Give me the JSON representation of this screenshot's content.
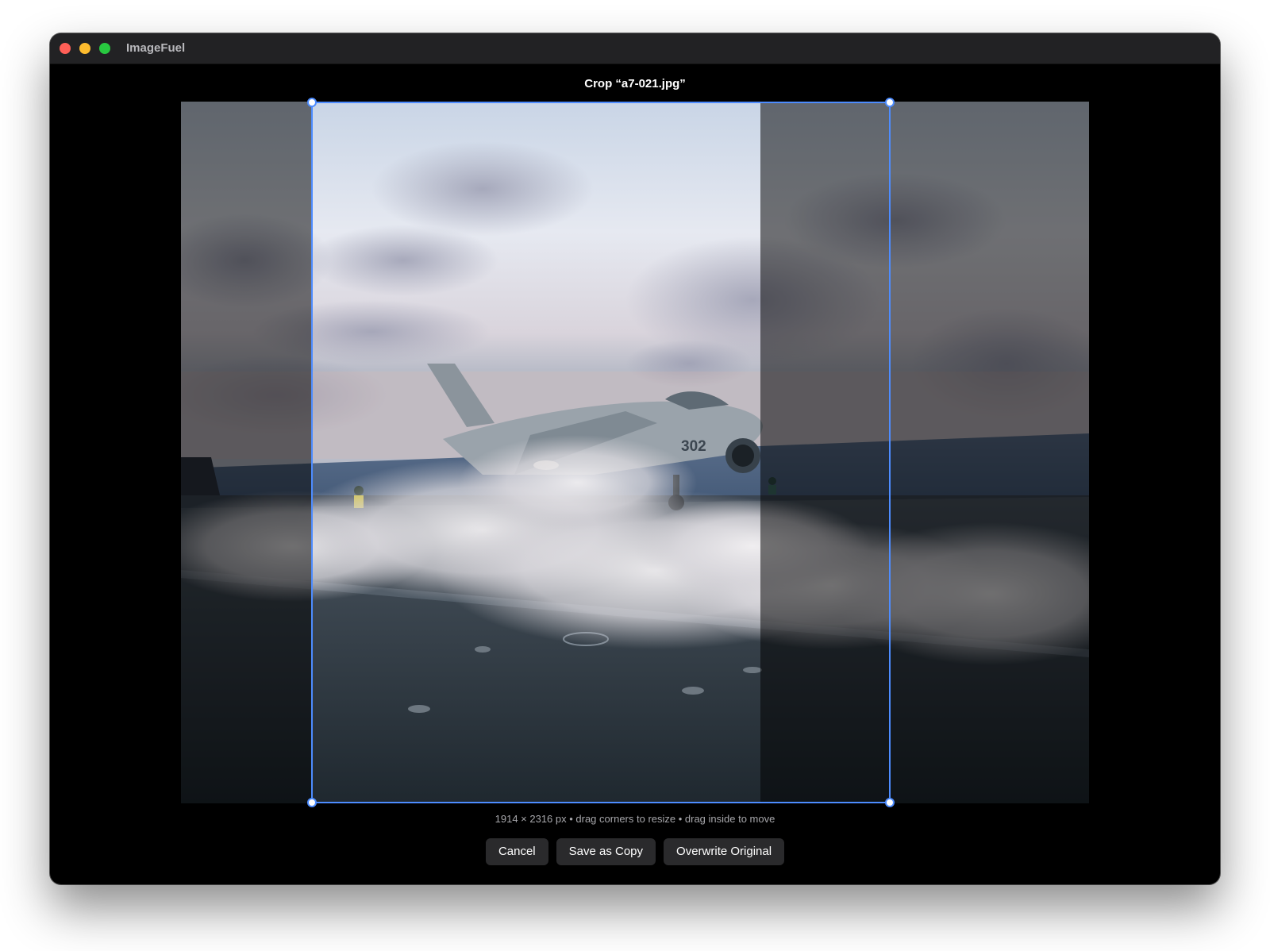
{
  "window": {
    "app_title": "ImageFuel"
  },
  "dialog": {
    "title": "Crop “a7-021.jpg”",
    "hint": "1914 × 2316 px • drag corners to resize • drag inside to move"
  },
  "buttons": {
    "cancel": "Cancel",
    "save_copy": "Save as Copy",
    "overwrite": "Overwrite Original"
  },
  "colors": {
    "crop_accent": "#4d8cff",
    "window_bg": "#000000",
    "button_bg": "#2a2a2c"
  },
  "image": {
    "subject": "A-7 Corsair jet on aircraft carrier catapult with steam",
    "tail_number": "302"
  }
}
